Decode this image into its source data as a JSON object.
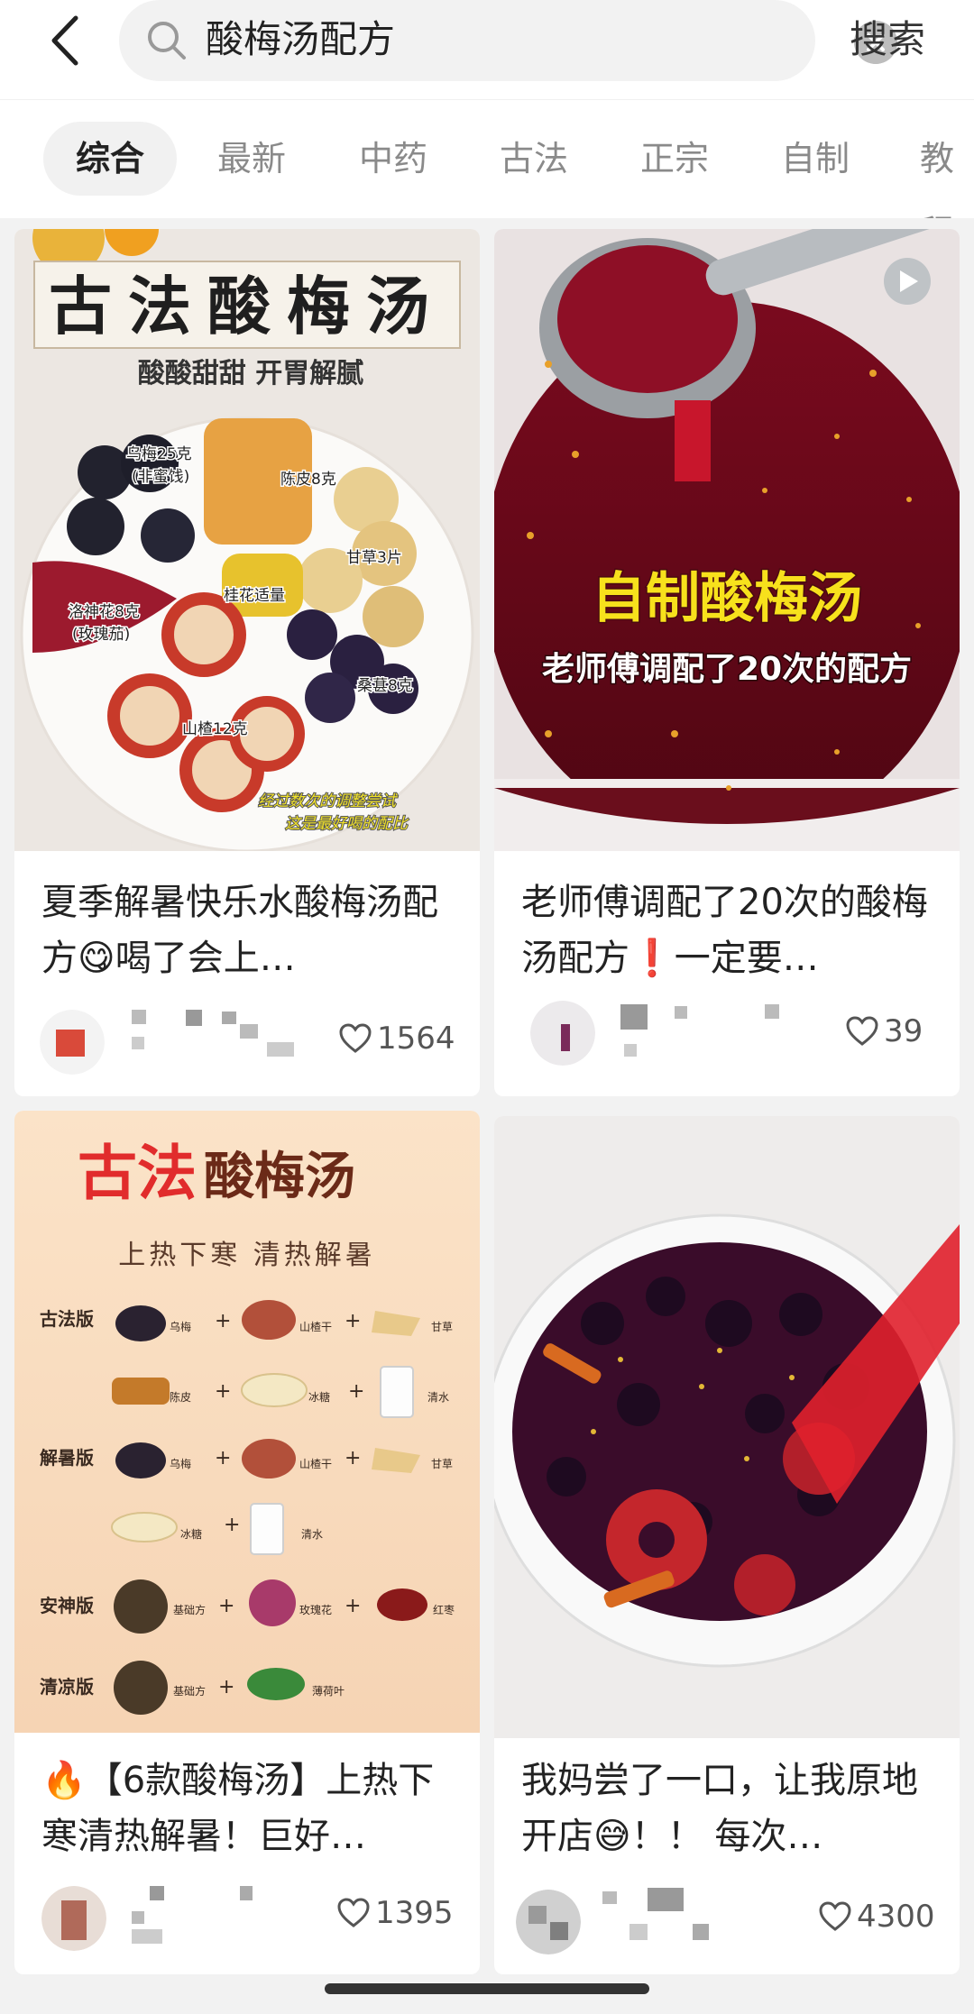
{
  "search": {
    "query": "酸梅汤配方",
    "button": "搜索"
  },
  "tabs": [
    "综合",
    "最新",
    "中药",
    "古法",
    "正宗",
    "自制",
    "教程"
  ],
  "cards": [
    {
      "image": {
        "heading": "古法酸梅汤",
        "subheading": "酸酸甜甜 开胃解腻",
        "labels": [
          "乌梅25克",
          "(非蜜饯)",
          "陈皮8克",
          "甘草3片",
          "桂花适量",
          "洛神花8克",
          "(玫瑰茄)",
          "桑葚8克",
          "山楂12克"
        ],
        "note1": "经过数次的调整尝试",
        "note2": "这是最好喝的配比"
      },
      "title": "夏季解暑快乐水酸梅汤配方😋喝了会上…",
      "likes": "1564"
    },
    {
      "image": {
        "heading": "自制酸梅汤",
        "subheading": "老师傅调配了20次的配方"
      },
      "title": "老师傅调配了20次的酸梅汤配方❗一定要…",
      "likes": "39"
    },
    {
      "image": {
        "heading_red": "古法",
        "heading_dark": "酸梅汤",
        "subheading": "上热下寒 清热解暑",
        "rows": [
          {
            "label": "古法版",
            "items": [
              "乌梅",
              "山楂干",
              "甘草"
            ]
          },
          {
            "label": "",
            "items": [
              "陈皮",
              "冰糖",
              "清水"
            ]
          },
          {
            "label": "解暑版",
            "items": [
              "乌梅",
              "山楂干",
              "甘草"
            ]
          },
          {
            "label": "",
            "items": [
              "冰糖",
              "清水"
            ]
          },
          {
            "label": "安神版",
            "items": [
              "基础方",
              "玫瑰花",
              "红枣"
            ]
          },
          {
            "label": "清凉版",
            "items": [
              "基础方",
              "薄荷叶"
            ]
          }
        ]
      },
      "title": "🔥【6款酸梅汤】上热下寒清热解暑！巨好…",
      "likes": "1395"
    },
    {
      "title": "我妈尝了一口，让我原地开店😅！！ 每次…",
      "likes": "4300"
    }
  ]
}
